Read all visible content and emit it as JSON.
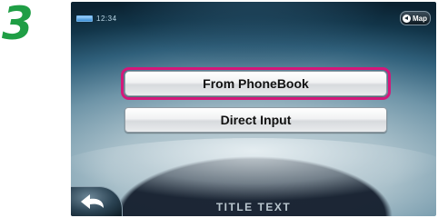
{
  "step": {
    "number": "3"
  },
  "status": {
    "clock": "12:34"
  },
  "header": {
    "map_button_label": "Map"
  },
  "menu": {
    "items": [
      {
        "label": "From PhoneBook",
        "selected": true
      },
      {
        "label": "Direct Input",
        "selected": false
      }
    ]
  },
  "footer": {
    "title": "TITLE TEXT"
  },
  "icons": {
    "back": "back-arrow-icon",
    "map": "map-arrow-icon",
    "battery": "battery-icon"
  },
  "colors": {
    "step_number": "#1f9e45",
    "selection_highlight": "#d4187a",
    "screen_background": "#2f5f7a"
  }
}
